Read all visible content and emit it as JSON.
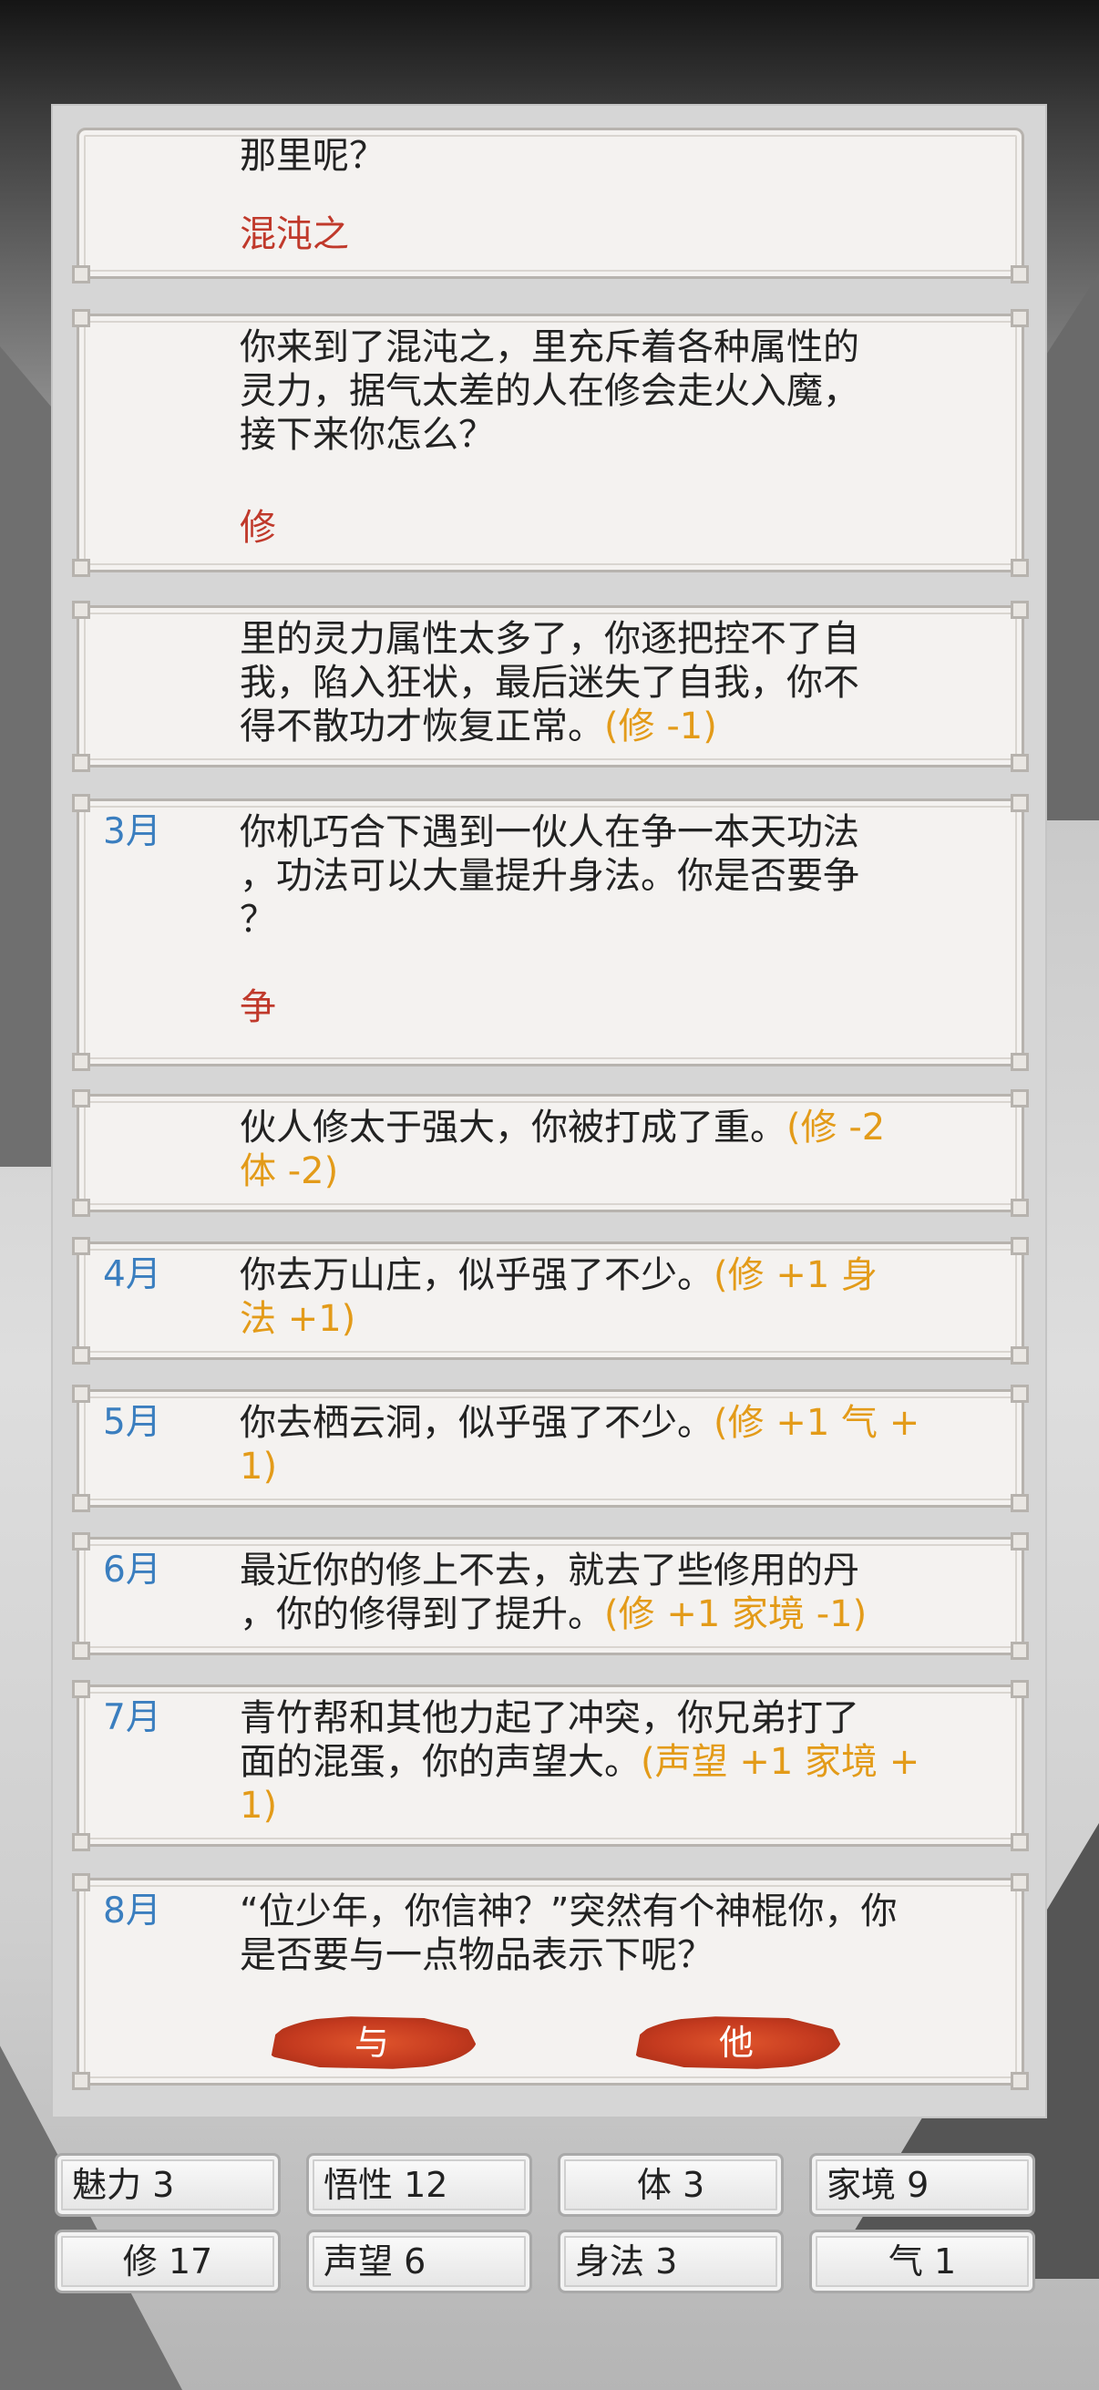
{
  "events": [
    {
      "month": "",
      "text": "那里呢？",
      "effect": "",
      "choice": "混沌之"
    },
    {
      "month": "",
      "text": "你来到了混沌之，里充斥着各种属性的灵力，据气太差的人在修会走火入魔，接下来你怎么？",
      "effect": "",
      "choice": "修"
    },
    {
      "month": "",
      "text": "里的灵力属性太多了，你逐把控不了自我，陷入狂状，最后迷失了自我，你不得不散功才恢复正常。",
      "effect": "(修 -1)",
      "choice": ""
    },
    {
      "month": "3月",
      "text": "你机巧合下遇到一伙人在争一本天功法，功法可以大量提升身法。你是否要争？",
      "effect": "",
      "choice": "争"
    },
    {
      "month": "",
      "text": "伙人修太于强大，你被打成了重。",
      "effect": "(修 -2 体 -2)",
      "choice": ""
    },
    {
      "month": "4月",
      "text": "你去万山庄，似乎强了不少。",
      "effect": "(修 +1 身法 +1)",
      "choice": ""
    },
    {
      "month": "5月",
      "text": "你去栖云洞，似乎强了不少。",
      "effect": "(修 +1 气 +1)",
      "choice": ""
    },
    {
      "month": "6月",
      "text": "最近你的修上不去，就去了些修用的丹，你的修得到了提升。",
      "effect": "(修 +1 家境 -1)",
      "choice": ""
    },
    {
      "month": "7月",
      "text": "青竹帮和其他力起了冲突，你兄弟打了面的混蛋，你的声望大。",
      "effect": "(声望 +1 家境 +1)",
      "choice": ""
    },
    {
      "month": "8月",
      "text": "“位少年，你信神？”突然有个神棍你，你是否要与一点物品表示下呢？",
      "effect": "",
      "choice": ""
    }
  ],
  "lines": {
    "e0": [
      "那里呢？"
    ],
    "e1": [
      "你来到了混沌之，里充斥着各种属性的",
      "灵力，据气太差的人在修会走火入魔，",
      "接下来你怎么？"
    ],
    "e2": [
      "里的灵力属性太多了，你逐把控不了自",
      "我，陷入狂状，最后迷失了自我，你不",
      "得不散功才恢复正常。"
    ],
    "e3": [
      "你机巧合下遇到一伙人在争一本天功法",
      "，功法可以大量提升身法。你是否要争",
      "？"
    ],
    "e4a": "伙人修太于强大，你被打成了重。",
    "e4b": "(修 -2",
    "e4c": "体 -2)",
    "e5a": "你去万山庄，似乎强了不少。",
    "e5b": "(修 +1 身",
    "e5c": "法 +1)",
    "e6a": "你去栖云洞，似乎强了不少。",
    "e6b": "(修 +1 气 +",
    "e6c": "1)",
    "e7a": "最近你的修上不去，就去了些修用的丹",
    "e7b": "，你的修得到了提升。",
    "e7c": "(修 +1 家境 -1)",
    "e8a": "青竹帮和其他力起了冲突，你兄弟打了",
    "e8b": "面的混蛋，你的声望大。",
    "e8c": "(声望 +1 家境 +",
    "e8d": "1)",
    "e9a": "“位少年，你信神？”突然有个神棍你，你",
    "e9b": "是否要与一点物品表示下呢？"
  },
  "options": {
    "give": "与",
    "other": "他"
  },
  "stats": [
    {
      "label": "魅力",
      "value": "3"
    },
    {
      "label": "悟性",
      "value": "12"
    },
    {
      "label": "体",
      "value": "3"
    },
    {
      "label": "家境",
      "value": "9"
    },
    {
      "label": "修",
      "value": "17"
    },
    {
      "label": "声望",
      "value": "6"
    },
    {
      "label": "身法",
      "value": "3"
    },
    {
      "label": "气",
      "value": "1"
    }
  ],
  "colors": {
    "month": "#3a7ebf",
    "effect": "#e39b19",
    "choice": "#c0392b"
  }
}
